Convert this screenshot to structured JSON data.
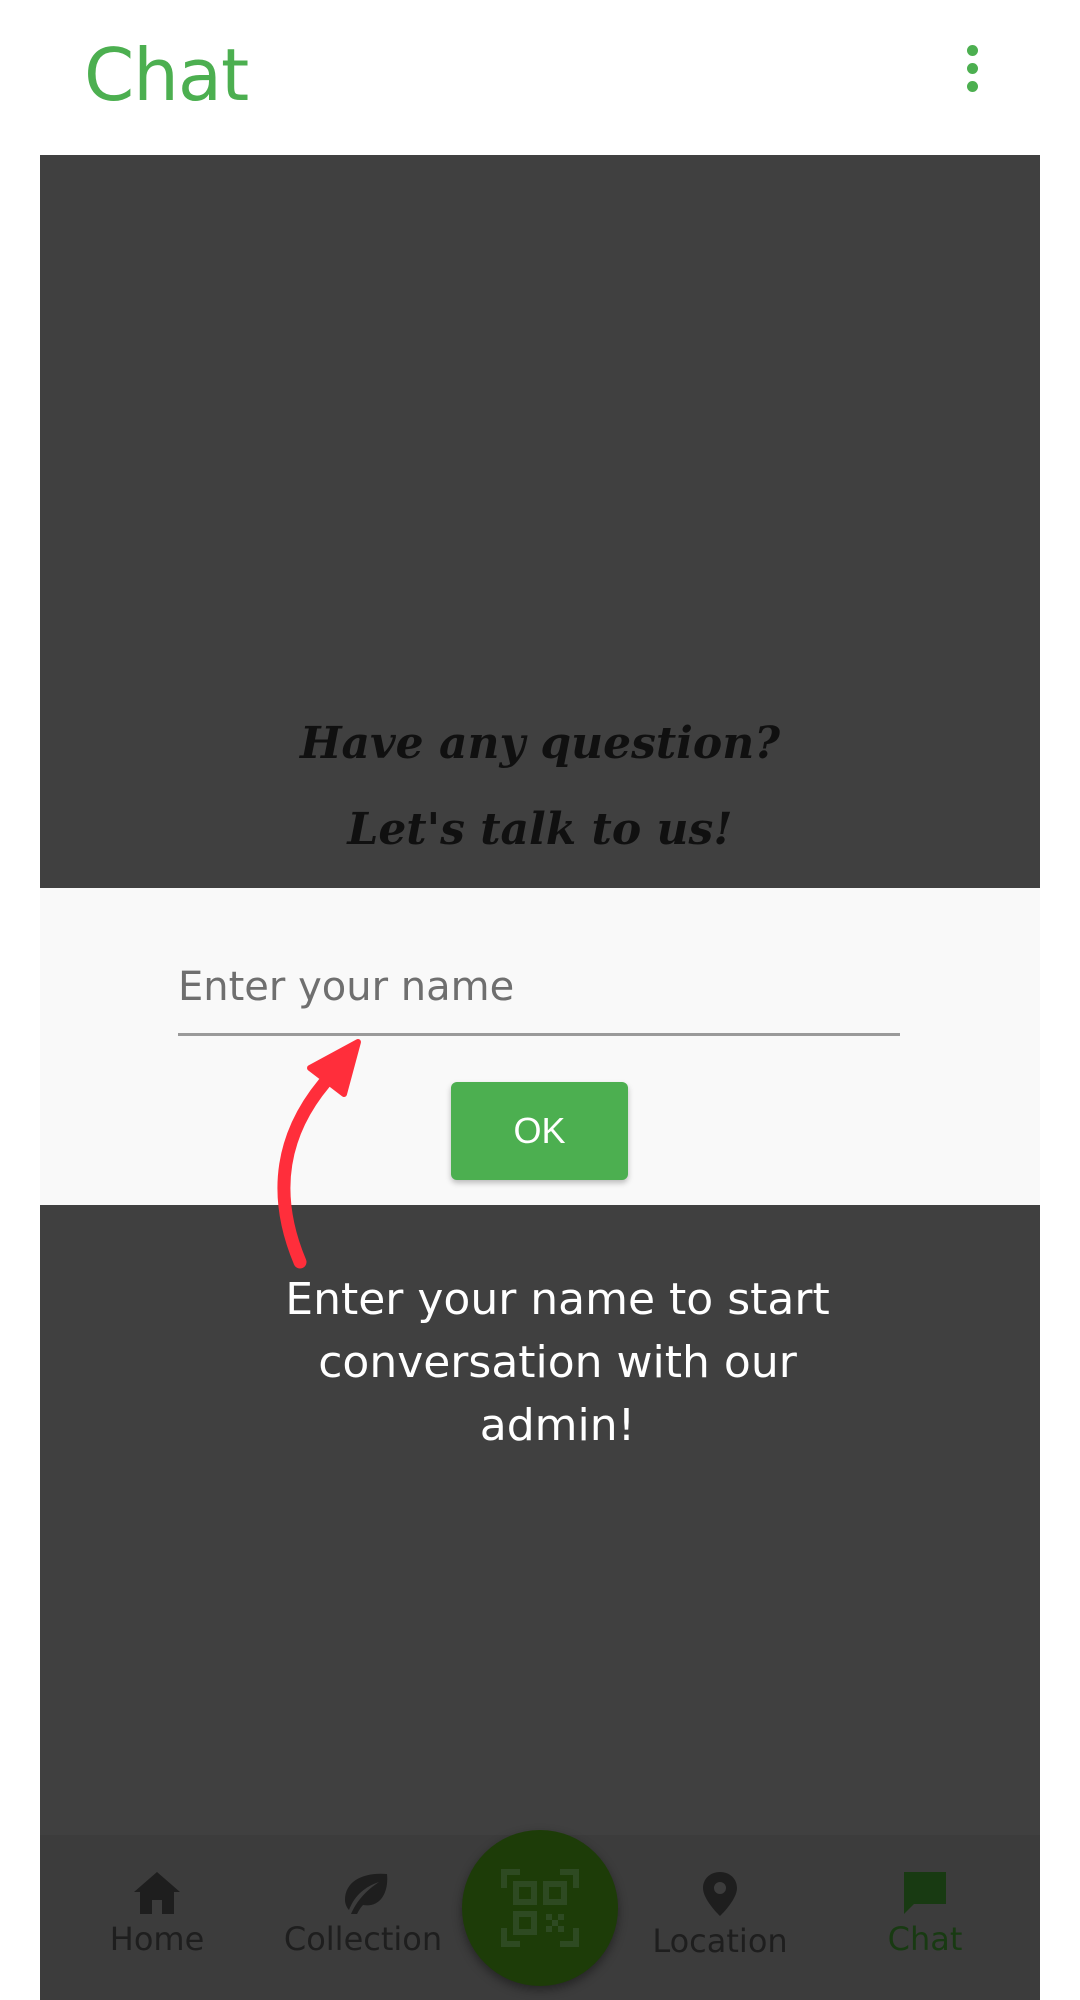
{
  "app_bar": {
    "title": "Chat",
    "menu_icon": "more-vert-icon"
  },
  "prompt": {
    "line1": "Have any question?",
    "line2": "Let's talk to us!"
  },
  "dialog": {
    "name_placeholder": "Enter your name",
    "name_value": "",
    "ok_label": "OK"
  },
  "hint": {
    "text": "Enter your name to start conversation with our admin!"
  },
  "bottom_nav": {
    "items": [
      {
        "label": "Home",
        "icon": "home-icon"
      },
      {
        "label": "Collection",
        "icon": "leaf-icon"
      },
      {
        "label": "Location",
        "icon": "location-pin-icon"
      },
      {
        "label": "Chat",
        "icon": "chat-icon"
      }
    ],
    "active": "Chat",
    "scan_icon": "qr-scanner-icon"
  },
  "colors": {
    "accent": "#4caf50",
    "overlay": "#404040",
    "arrow": "#ff2e3b"
  }
}
